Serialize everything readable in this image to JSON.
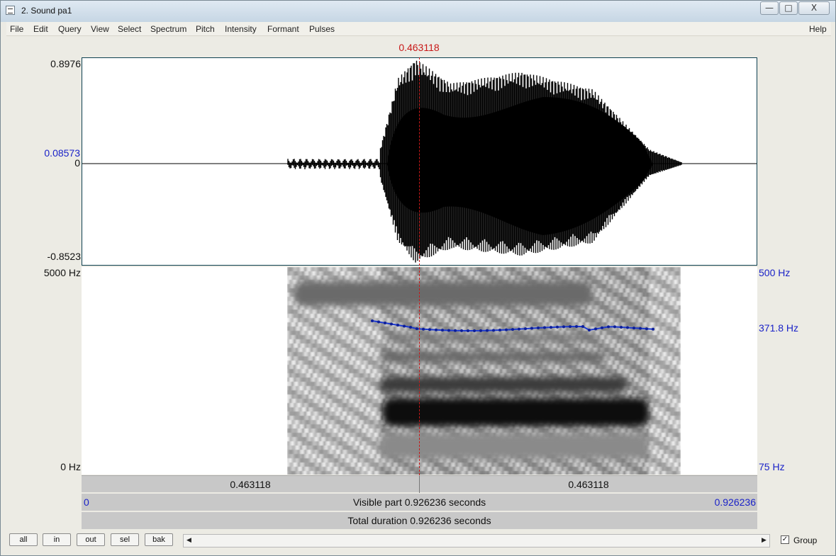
{
  "window": {
    "title": "2. Sound pa1"
  },
  "window_controls": {
    "minimize": "—",
    "maximize": "□",
    "close": "X"
  },
  "menu": [
    "File",
    "Edit",
    "Query",
    "View",
    "Select",
    "Spectrum",
    "Pitch",
    "Intensity",
    "Formant",
    "Pulses"
  ],
  "help": "Help",
  "cursor": {
    "time_label": "0.463118"
  },
  "waveform": {
    "max_label": "0.8976",
    "cursor_value_label": "0.08573",
    "zero_label": "0",
    "min_label": "-0.8523"
  },
  "spectrogram": {
    "top_label": "5000 Hz",
    "bottom_label": "0 Hz"
  },
  "pitch": {
    "top_label": "500 Hz",
    "value_label": "371.8 Hz",
    "bottom_label": "75 Hz"
  },
  "bars": {
    "left_time": "0.463118",
    "right_time": "0.463118",
    "visible_start": "0",
    "visible_text": "Visible part 0.926236 seconds",
    "visible_end": "0.926236",
    "total_text": "Total duration 0.926236 seconds"
  },
  "buttons": [
    "all",
    "in",
    "out",
    "sel",
    "bak"
  ],
  "scroll": {
    "left_arrow": "◀",
    "right_arrow": "▶"
  },
  "group": {
    "label": "Group",
    "checked": "✓"
  },
  "colors": {
    "cursor": "#c81818",
    "axis_blue": "#1a22c8",
    "pitch_line": "#1d3ad0",
    "waveform": "#000000"
  }
}
